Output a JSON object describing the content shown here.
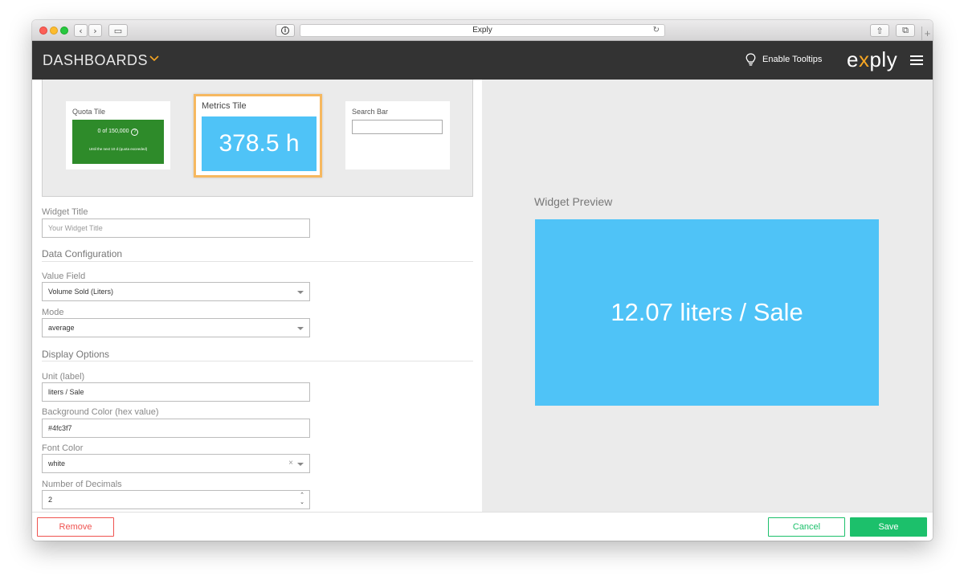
{
  "browser": {
    "url_text": "Exply",
    "reload_glyph": "↻",
    "info_glyph": "i",
    "back_glyph": "‹",
    "forward_glyph": "›",
    "sidebar_glyph": "▭",
    "share_glyph": "⇧",
    "tabs_glyph": "⧉",
    "new_tab_glyph": "+"
  },
  "header": {
    "title": "DASHBOARDS",
    "tooltips_label": "Enable Tooltips",
    "logo_pre": "e",
    "logo_x": "x",
    "logo_post": "ply",
    "colors": {
      "background": "#333333",
      "accent": "#f6a623"
    }
  },
  "tiles": {
    "quota": {
      "caption": "Quota Tile",
      "main_text": "0 of 150,000",
      "help_glyph": "?",
      "sub_text": "Until the next 10 d (quota exceeded)",
      "color": "#2e8b2a"
    },
    "metrics": {
      "caption": "Metrics Tile",
      "value": "378.5 h",
      "color": "#4fc3f7",
      "selected_border": "#f6b860"
    },
    "search": {
      "caption": "Search Bar"
    }
  },
  "form": {
    "widget_title_label": "Widget Title",
    "widget_title_placeholder": "Your Widget Title",
    "data_config_heading": "Data Configuration",
    "value_field_label": "Value Field",
    "value_field_value": "Volume Sold (Liters)",
    "mode_label": "Mode",
    "mode_value": "average",
    "display_options_heading": "Display Options",
    "unit_label": "Unit (label)",
    "unit_value": "liters / Sale",
    "bg_color_label": "Background Color (hex value)",
    "bg_color_value": "#4fc3f7",
    "font_color_label": "Font Color",
    "font_color_value": "white",
    "clear_glyph": "×",
    "decimals_label": "Number of Decimals",
    "decimals_value": "2",
    "spin_up": "⌃",
    "spin_down": "⌄"
  },
  "preview": {
    "label": "Widget Preview",
    "value_text": "12.07 liters / Sale",
    "background": "#4fc3f7",
    "font_color": "white"
  },
  "footer": {
    "remove_label": "Remove",
    "cancel_label": "Cancel",
    "save_label": "Save",
    "colors": {
      "remove": "#ef5350",
      "save": "#1cc06b"
    }
  }
}
